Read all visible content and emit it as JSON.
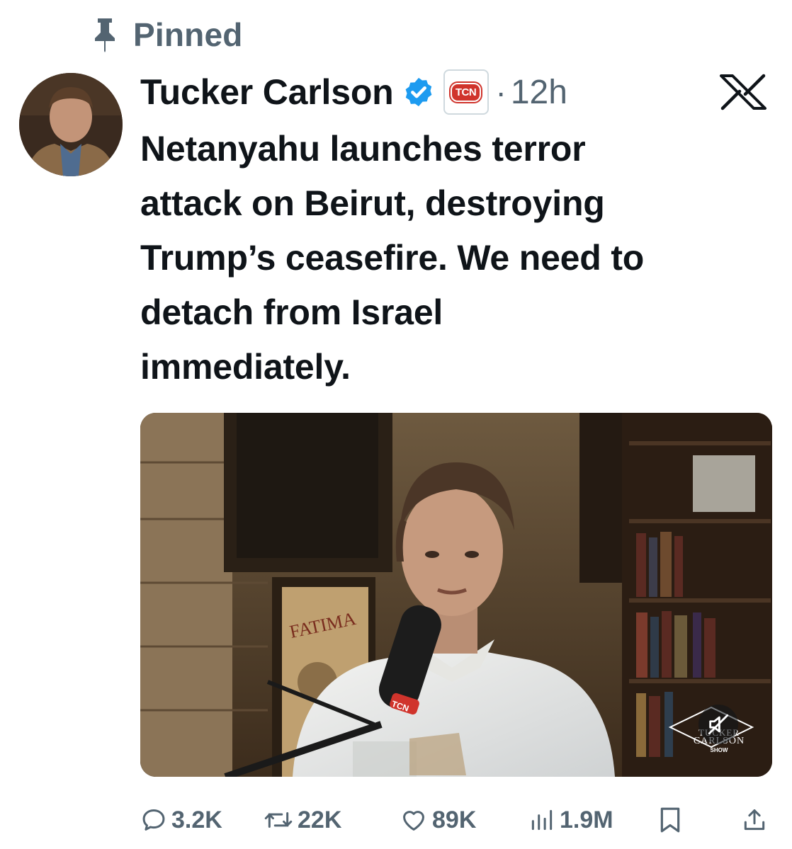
{
  "pinned": {
    "label": "Pinned",
    "icon": "pin-icon"
  },
  "author": {
    "name": "Tucker Carlson",
    "verified_icon": "verified-badge-icon",
    "affiliate_badge": "TCN",
    "separator": "·",
    "timestamp": "12h"
  },
  "platform": {
    "logo": "x-logo"
  },
  "tweet": {
    "text": "Netanyahu launches terror\nattack on Beirut, destroying\nTrump’s ceasefire. We need to\ndetach from Israel\nimmediately."
  },
  "media": {
    "poster_text": "FATIMA",
    "mic_brand": "TCN",
    "show_logo": {
      "line1": "TUCKER",
      "line2": "CARLSON",
      "line3": "SHOW"
    },
    "mute_icon": "muted-speaker-icon"
  },
  "actions": {
    "reply": {
      "count": "3.2K",
      "icon": "reply-icon"
    },
    "repost": {
      "count": "22K",
      "icon": "repost-icon"
    },
    "like": {
      "count": "89K",
      "icon": "heart-icon"
    },
    "views": {
      "count": "1.9M",
      "icon": "views-icon"
    },
    "bookmark": {
      "icon": "bookmark-icon"
    },
    "share": {
      "icon": "share-icon"
    }
  },
  "colors": {
    "text_primary": "#0f1419",
    "text_secondary": "#536471",
    "verified": "#1d9bf0",
    "affiliate": "#d0342c"
  }
}
